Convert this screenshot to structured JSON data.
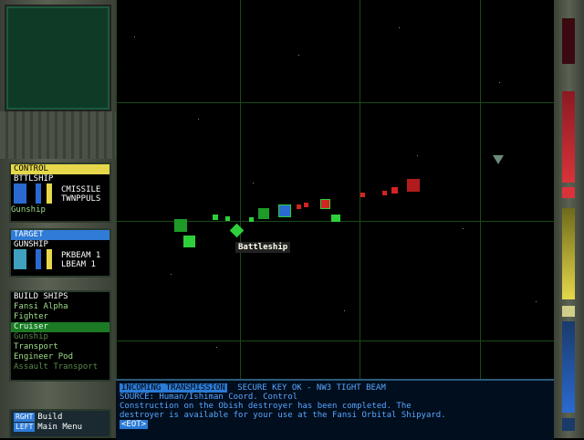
{
  "control": {
    "header": "CONTROL",
    "ship": "BTTLSHIP",
    "weapon1": "CMISSILE",
    "weapon2": "TWNPPULS",
    "class": "Gunship"
  },
  "target": {
    "header": "TARGET",
    "ship": "GUNSHIP",
    "weapon1": "PKBEAM 1",
    "weapon2": "LBEAM 1"
  },
  "build": {
    "header": "BUILD SHIPS",
    "items": [
      "Fansi Alpha",
      "Fighter",
      "Cruiser",
      "Gunship",
      "Transport",
      "Engineer Pod",
      "Assault Transport"
    ],
    "selected": "Cruiser"
  },
  "hints": {
    "key1": "RGHT",
    "label1": "Build",
    "key2": "LEFT",
    "label2": "Main Menu"
  },
  "tooltip": "Battleship",
  "message": {
    "title": "INCOMING TRANSMISSION",
    "status": "SECURE KEY OK - NW3 TIGHT BEAM",
    "source": "SOURCE: Human/Ishiman Coord. Control",
    "line1": "Construction on the Obish destroyer has been completed. The",
    "line2": "destroyer is available for your use at the Fansi Orbital Shipyard.",
    "end": "<EOT>"
  },
  "colors": {
    "friendly": "#2dcf3a",
    "enemy": "#d42323",
    "panel": "#5a6152",
    "grid": "#184a18",
    "accent": "#e6d84a"
  }
}
